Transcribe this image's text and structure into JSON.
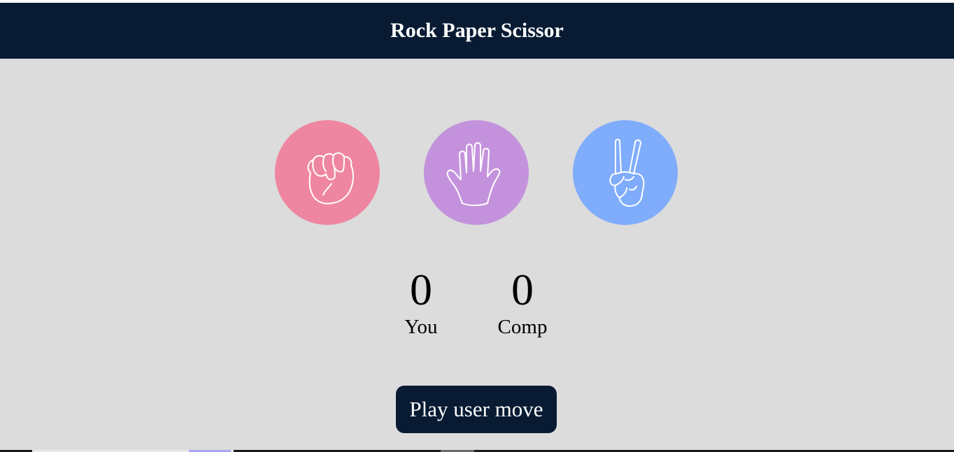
{
  "header": {
    "title": "Rock Paper Scissor"
  },
  "choices": [
    {
      "id": "rock",
      "icon": "fist-icon",
      "color": "#ef86a1"
    },
    {
      "id": "paper",
      "icon": "open-hand-icon",
      "color": "#c492dc"
    },
    {
      "id": "scissor",
      "icon": "peace-hand-icon",
      "color": "#80acfc"
    }
  ],
  "scoreboard": {
    "user": {
      "score": "0",
      "label": "You"
    },
    "comp": {
      "score": "0",
      "label": "Comp"
    }
  },
  "action": {
    "play_label": "Play user move"
  },
  "colors": {
    "header_bg": "#081b33",
    "page_bg": "#dcdcdc"
  }
}
